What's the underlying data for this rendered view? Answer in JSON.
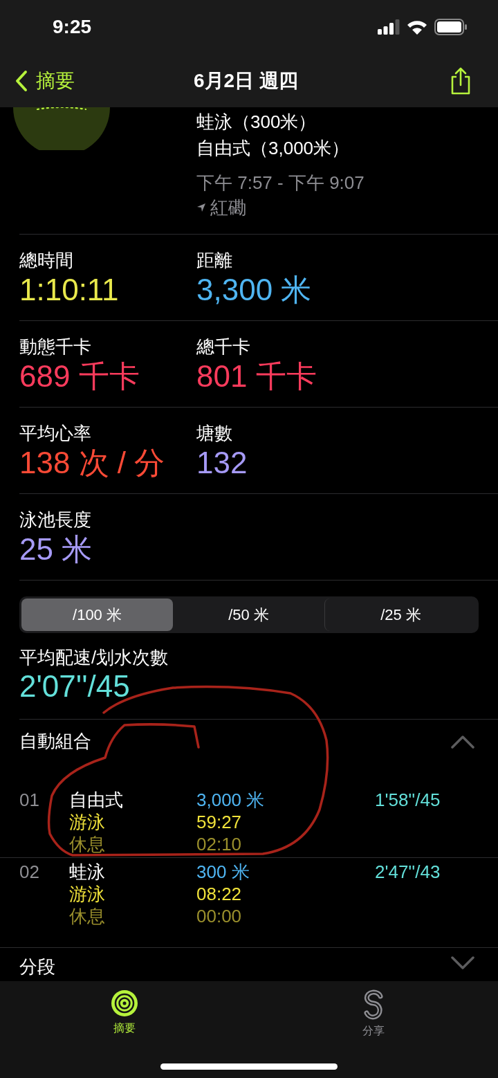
{
  "status_bar": {
    "time": "9:25"
  },
  "nav": {
    "back": "摘要",
    "title": "6月2日 週四"
  },
  "workout": {
    "strokes": [
      "蛙泳（300米）",
      "自由式（3,000米）"
    ],
    "time_range": "下午 7:57 - 下午 9:07",
    "location": "紅磡"
  },
  "stats": [
    {
      "label": "總時間",
      "value": "1:10:11",
      "color": "#e8e84c"
    },
    {
      "label": "距離",
      "value": "3,300 米",
      "color": "#4fb5f2"
    },
    {
      "label": "動態千卡",
      "value": "689 千卡",
      "color": "#fa3b5c"
    },
    {
      "label": "總千卡",
      "value": "801 千卡",
      "color": "#fa3b5c"
    },
    {
      "label": "平均心率",
      "value": "138 次 / 分",
      "color": "#fb4a36"
    },
    {
      "label": "塘數",
      "value": "132",
      "color": "#a69af7"
    },
    {
      "label": "泳池長度",
      "value": "25 米",
      "color": "#a69af7"
    }
  ],
  "segments": [
    {
      "label": "/100 米",
      "selected": true
    },
    {
      "label": "/50 米",
      "selected": false
    },
    {
      "label": "/25 米",
      "selected": false
    }
  ],
  "pace": {
    "label": "平均配速/划水次數",
    "value": "2'07''/45"
  },
  "auto_sets": {
    "title": "自動組合",
    "expanded": true,
    "rows": [
      {
        "index": "01",
        "stroke": "自由式",
        "distance": "3,000 米",
        "swim_label": "游泳",
        "swim_time": "59:27",
        "rest_label": "休息",
        "rest_time": "02:10",
        "pace": "1'58''/45"
      },
      {
        "index": "02",
        "stroke": "蛙泳",
        "distance": "300 米",
        "swim_label": "游泳",
        "swim_time": "08:22",
        "rest_label": "休息",
        "rest_time": "00:00",
        "pace": "2'47''/43"
      }
    ]
  },
  "splits": {
    "title": "分段",
    "expanded": false
  },
  "tab_bar": [
    {
      "label": "摘要",
      "kind": "summary",
      "selected": true
    },
    {
      "label": "分享",
      "kind": "sharing",
      "selected": false
    }
  ]
}
